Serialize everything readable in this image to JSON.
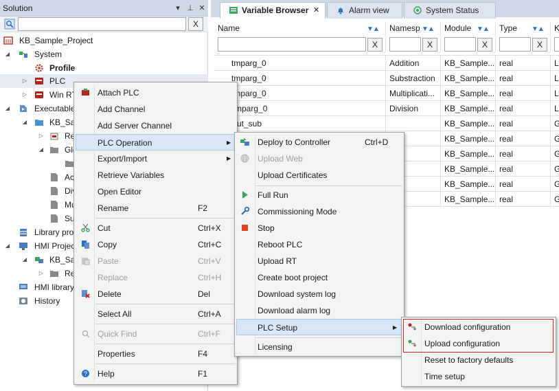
{
  "solution": {
    "title": "Solution",
    "search_placeholder": "",
    "clear_label": "X",
    "tree": [
      {
        "label": "KB_Sample_Project"
      },
      {
        "label": "System"
      },
      {
        "label": "Profile"
      },
      {
        "label": "PLC"
      },
      {
        "label": "Win RT"
      },
      {
        "label": "Executable"
      },
      {
        "label": "KB_San"
      },
      {
        "label": "Re"
      },
      {
        "label": "Glo"
      },
      {
        "label": ""
      },
      {
        "label": "Ac"
      },
      {
        "label": "Div"
      },
      {
        "label": "Mu"
      },
      {
        "label": "Su"
      },
      {
        "label": "Library pro"
      },
      {
        "label": "HMI Projec"
      },
      {
        "label": "KB_San"
      },
      {
        "label": "Re"
      },
      {
        "label": "HMI library"
      },
      {
        "label": "History"
      }
    ]
  },
  "tabs": [
    {
      "label": "Variable Browser",
      "close": "✕"
    },
    {
      "label": "Alarm view"
    },
    {
      "label": "System Status"
    }
  ],
  "grid": {
    "columns": [
      "Name",
      "Namesp",
      "Module",
      "Type",
      "K"
    ],
    "clear_label": "X",
    "rows": [
      [
        "tmparg_0",
        "Addition",
        "KB_Sample...",
        "real",
        "Lo"
      ],
      [
        "tmparg_0",
        "Substraction",
        "KB_Sample...",
        "real",
        "Lo"
      ],
      [
        "tmparg_0",
        "Multiplicati...",
        "KB_Sample...",
        "real",
        "Lo"
      ],
      [
        "mparg_0",
        "Division",
        "KB_Sample...",
        "real",
        "Lo"
      ],
      [
        "ut_sub",
        "",
        "KB_Sample...",
        "real",
        "G"
      ],
      [
        "",
        "",
        "KB_Sample...",
        "real",
        "G"
      ],
      [
        "",
        "",
        "KB_Sample...",
        "real",
        "G"
      ],
      [
        "",
        "",
        "KB_Sample...",
        "real",
        "G"
      ],
      [
        "",
        "",
        "KB_Sample...",
        "real",
        "G"
      ],
      [
        "",
        "",
        "KB_Sample...",
        "real",
        "G"
      ]
    ]
  },
  "context_menu": {
    "items": [
      {
        "label": "Attach PLC",
        "shortcut": ""
      },
      {
        "label": "Add Channel",
        "shortcut": ""
      },
      {
        "label": "Add Server Channel",
        "shortcut": ""
      },
      {
        "label": "PLC Operation",
        "shortcut": ""
      },
      {
        "label": "Export/Import",
        "shortcut": ""
      },
      {
        "label": "Retrieve Variables",
        "shortcut": ""
      },
      {
        "label": "Open Editor",
        "shortcut": ""
      },
      {
        "label": "Rename",
        "shortcut": "F2"
      },
      {
        "label": "Cut",
        "shortcut": "Ctrl+X"
      },
      {
        "label": "Copy",
        "shortcut": "Ctrl+C"
      },
      {
        "label": "Paste",
        "shortcut": "Ctrl+V"
      },
      {
        "label": "Replace",
        "shortcut": "Ctrl+H"
      },
      {
        "label": "Delete",
        "shortcut": "Del"
      },
      {
        "label": "Select All",
        "shortcut": "Ctrl+A"
      },
      {
        "label": "Quick Find",
        "shortcut": "Ctrl+F"
      },
      {
        "label": "Properties",
        "shortcut": "F4"
      },
      {
        "label": "Help",
        "shortcut": "F1"
      }
    ]
  },
  "plc_operation_menu": {
    "items": [
      {
        "label": "Deploy to Controller",
        "shortcut": "Ctrl+D"
      },
      {
        "label": "Upload Web",
        "shortcut": ""
      },
      {
        "label": "Upload Certificates",
        "shortcut": ""
      },
      {
        "label": "Full Run",
        "shortcut": ""
      },
      {
        "label": "Commissioning Mode",
        "shortcut": ""
      },
      {
        "label": "Stop",
        "shortcut": ""
      },
      {
        "label": "Reboot PLC",
        "shortcut": ""
      },
      {
        "label": "Upload RT",
        "shortcut": ""
      },
      {
        "label": "Create boot project",
        "shortcut": ""
      },
      {
        "label": "Download system log",
        "shortcut": ""
      },
      {
        "label": "Download alarm log",
        "shortcut": ""
      },
      {
        "label": "PLC Setup",
        "shortcut": ""
      },
      {
        "label": "Licensing",
        "shortcut": ""
      }
    ]
  },
  "plc_setup_menu": {
    "items": [
      {
        "label": "Download configuration"
      },
      {
        "label": "Upload configuration"
      },
      {
        "label": "Reset to factory defaults"
      },
      {
        "label": "Time setup"
      }
    ]
  },
  "colors": {
    "header_bg": "#cfd8e6",
    "menu_bg": "#f3f3f3",
    "highlight": "#d8e6f7",
    "annotation_box": "#d11f1f",
    "sort_icon": "#2e6fc0"
  }
}
